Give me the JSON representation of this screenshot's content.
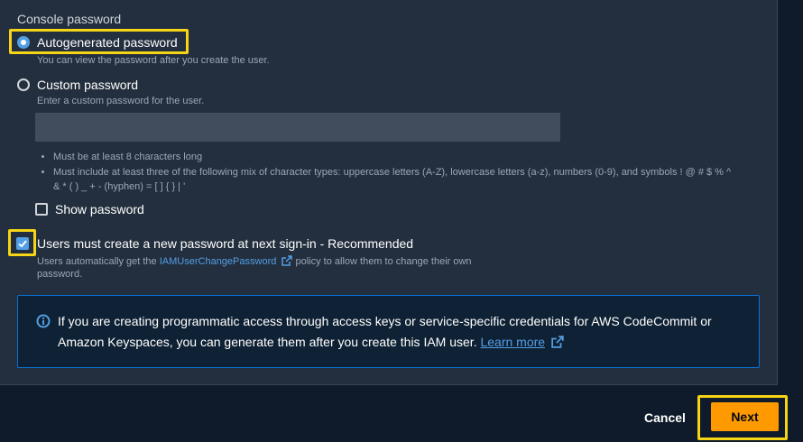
{
  "section": {
    "label": "Console password"
  },
  "autogen": {
    "label": "Autogenerated password",
    "hint": "You can view the password after you create the user.",
    "selected": true
  },
  "custom": {
    "label": "Custom password",
    "hint": "Enter a custom password for the user.",
    "input_value": "",
    "selected": false
  },
  "requirements": [
    "Must be at least 8 characters long",
    "Must include at least three of the following mix of character types: uppercase letters (A-Z), lowercase letters (a-z), numbers (0-9), and symbols ! @ # $ % ^ & * ( ) _ + - (hyphen) = [ ] { } | '"
  ],
  "show_password": {
    "label": "Show password",
    "checked": false
  },
  "reset_required": {
    "label": "Users must create a new password at next sign-in - Recommended",
    "hint_prefix": "Users automatically get the",
    "hint_link": "IAMUserChangePassword",
    "hint_suffix": "policy to allow them to change their own",
    "hint_line2": "password.",
    "checked": true
  },
  "info": {
    "text": "If you are creating programmatic access through access keys or service-specific credentials for AWS CodeCommit or Amazon Keyspaces, you can generate them after you create this IAM user.",
    "link": "Learn more"
  },
  "footer": {
    "cancel": "Cancel",
    "next": "Next"
  },
  "colors": {
    "panel_bg": "#232f3e",
    "accent_blue": "#539fe5",
    "primary_orange": "#ff9900",
    "highlight_yellow": "#f5d515"
  }
}
